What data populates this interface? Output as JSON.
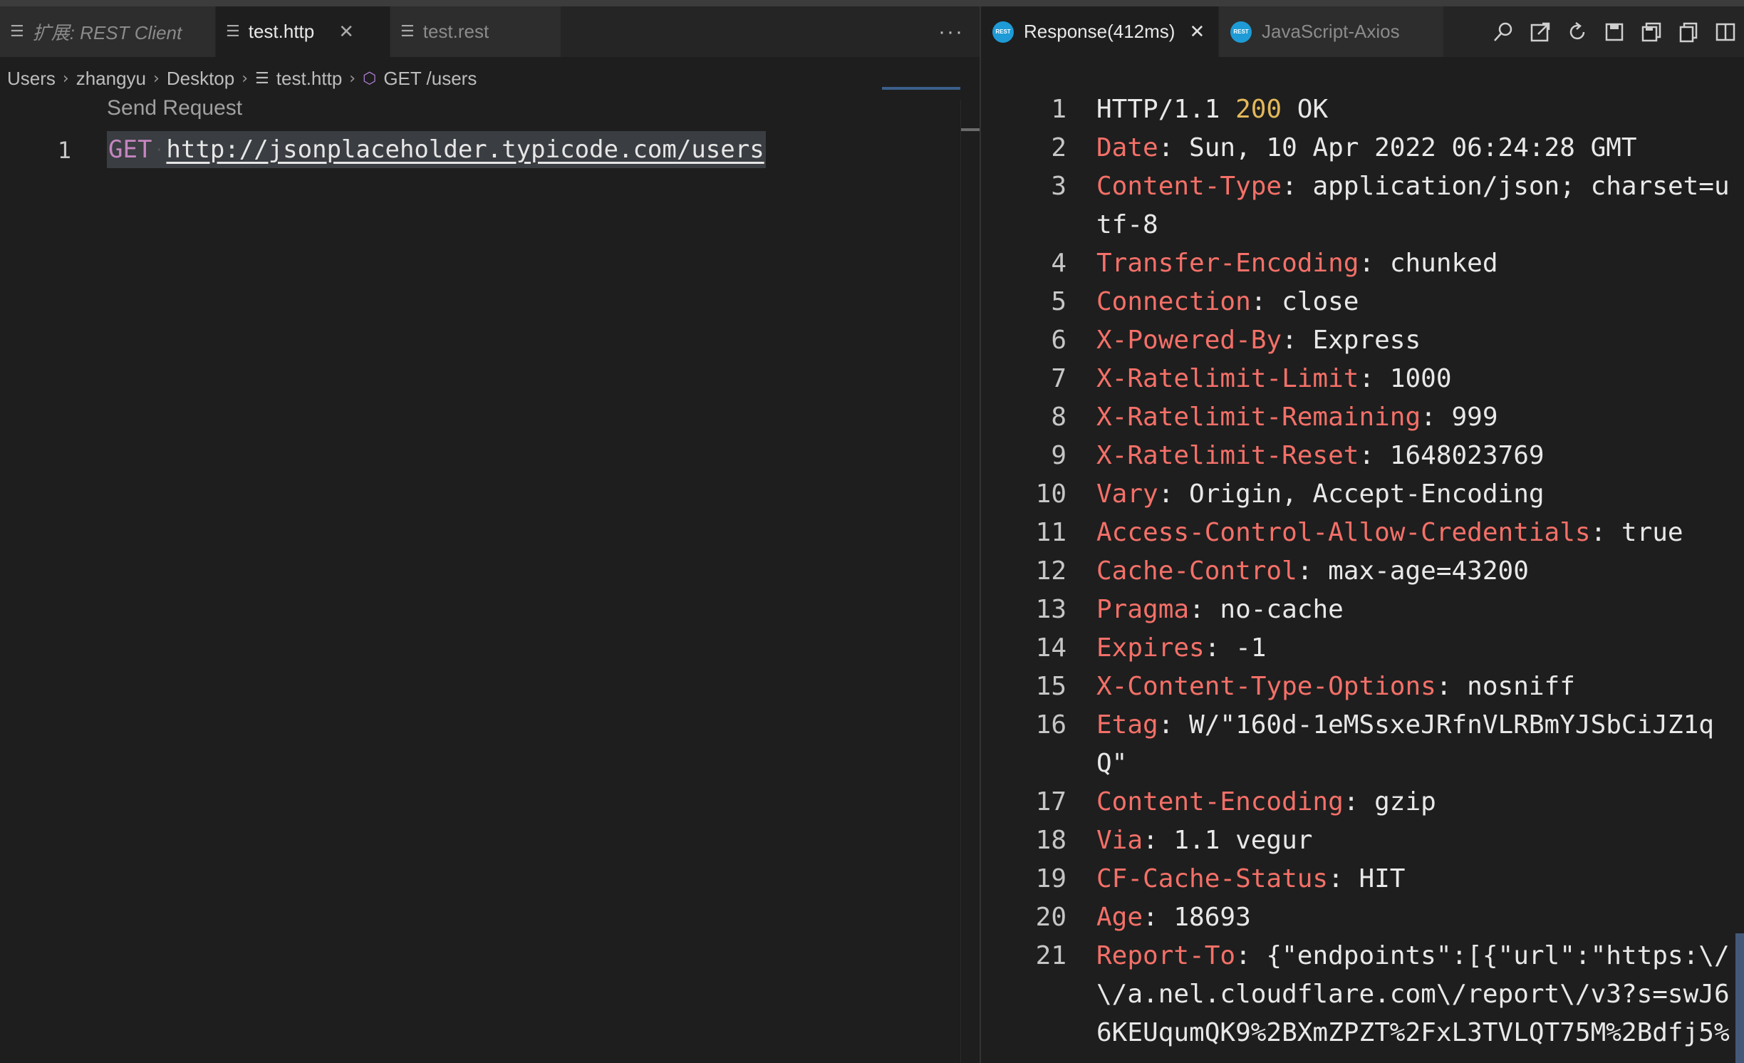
{
  "left": {
    "tabs": [
      {
        "label": "扩展: REST Client",
        "italic": true,
        "active": false
      },
      {
        "label": "test.http",
        "active": true,
        "closable": true
      },
      {
        "label": "test.rest",
        "active": false
      }
    ],
    "breadcrumb": [
      "Users",
      "zhangyu",
      "Desktop",
      "test.http",
      "GET /users"
    ],
    "codelens": "Send Request",
    "line_number": "1",
    "request": {
      "method": "GET",
      "url": "http://jsonplaceholder.typicode.com/users"
    }
  },
  "right": {
    "tabs": [
      {
        "label": "Response(412ms)",
        "active": true
      },
      {
        "label": "JavaScript-Axios",
        "active": false
      }
    ],
    "toolbar_icons": [
      "search-icon",
      "open-in-new-icon",
      "refresh-icon",
      "save-icon",
      "save-body-icon",
      "copy-icon",
      "split-editor-icon"
    ],
    "lines": [
      {
        "n": "1",
        "parts": [
          {
            "t": "HTTP/1.1 ",
            "c": ""
          },
          {
            "t": "200",
            "c": "num"
          },
          {
            "t": " OK",
            "c": ""
          }
        ]
      },
      {
        "n": "2",
        "parts": [
          {
            "t": "Date",
            "c": "k"
          },
          {
            "t": ": Sun, 10 Apr 2022 06:24:28 GMT",
            "c": ""
          }
        ]
      },
      {
        "n": "3",
        "parts": [
          {
            "t": "Content-Type",
            "c": "k"
          },
          {
            "t": ": application/json; charset=u",
            "c": ""
          }
        ]
      },
      {
        "n": "",
        "parts": [
          {
            "t": "tf-8",
            "c": ""
          }
        ]
      },
      {
        "n": "4",
        "parts": [
          {
            "t": "Transfer-Encoding",
            "c": "k"
          },
          {
            "t": ": chunked",
            "c": ""
          }
        ]
      },
      {
        "n": "5",
        "parts": [
          {
            "t": "Connection",
            "c": "k"
          },
          {
            "t": ": close",
            "c": ""
          }
        ]
      },
      {
        "n": "6",
        "parts": [
          {
            "t": "X-Powered-By",
            "c": "k"
          },
          {
            "t": ": Express",
            "c": ""
          }
        ]
      },
      {
        "n": "7",
        "parts": [
          {
            "t": "X-Ratelimit-Limit",
            "c": "k"
          },
          {
            "t": ": 1000",
            "c": ""
          }
        ]
      },
      {
        "n": "8",
        "parts": [
          {
            "t": "X-Ratelimit-Remaining",
            "c": "k"
          },
          {
            "t": ": 999",
            "c": ""
          }
        ]
      },
      {
        "n": "9",
        "parts": [
          {
            "t": "X-Ratelimit-Reset",
            "c": "k"
          },
          {
            "t": ": 1648023769",
            "c": ""
          }
        ]
      },
      {
        "n": "10",
        "parts": [
          {
            "t": "Vary",
            "c": "k"
          },
          {
            "t": ": Origin, Accept-Encoding",
            "c": ""
          }
        ]
      },
      {
        "n": "11",
        "parts": [
          {
            "t": "Access-Control-Allow-Credentials",
            "c": "k"
          },
          {
            "t": ": true",
            "c": ""
          }
        ]
      },
      {
        "n": "12",
        "parts": [
          {
            "t": "Cache-Control",
            "c": "k"
          },
          {
            "t": ": max-age=43200",
            "c": ""
          }
        ]
      },
      {
        "n": "13",
        "parts": [
          {
            "t": "Pragma",
            "c": "k"
          },
          {
            "t": ": no-cache",
            "c": ""
          }
        ]
      },
      {
        "n": "14",
        "parts": [
          {
            "t": "Expires",
            "c": "k"
          },
          {
            "t": ": -1",
            "c": ""
          }
        ]
      },
      {
        "n": "15",
        "parts": [
          {
            "t": "X-Content-Type-Options",
            "c": "k"
          },
          {
            "t": ": nosniff",
            "c": ""
          }
        ]
      },
      {
        "n": "16",
        "parts": [
          {
            "t": "Etag",
            "c": "k"
          },
          {
            "t": ": W/\"160d-1eMSsxeJRfnVLRBmYJSbCiJZ1q",
            "c": ""
          }
        ]
      },
      {
        "n": "",
        "parts": [
          {
            "t": "Q\"",
            "c": ""
          }
        ]
      },
      {
        "n": "17",
        "parts": [
          {
            "t": "Content-Encoding",
            "c": "k"
          },
          {
            "t": ": gzip",
            "c": ""
          }
        ]
      },
      {
        "n": "18",
        "parts": [
          {
            "t": "Via",
            "c": "k"
          },
          {
            "t": ": 1.1 vegur",
            "c": ""
          }
        ]
      },
      {
        "n": "19",
        "parts": [
          {
            "t": "CF-Cache-Status",
            "c": "k"
          },
          {
            "t": ": HIT",
            "c": ""
          }
        ]
      },
      {
        "n": "20",
        "parts": [
          {
            "t": "Age",
            "c": "k"
          },
          {
            "t": ": 18693",
            "c": ""
          }
        ]
      },
      {
        "n": "21",
        "parts": [
          {
            "t": "Report-To",
            "c": "k"
          },
          {
            "t": ": {\"endpoints\":[{\"url\":\"https:\\/",
            "c": ""
          }
        ]
      },
      {
        "n": "",
        "parts": [
          {
            "t": "\\/a.nel.cloudflare.com\\/report\\/v3?s=swJ6",
            "c": ""
          }
        ]
      },
      {
        "n": "",
        "parts": [
          {
            "t": "6KEUqumQK9%2BXmZPZT%2FxL3TVLQT75M%2Bdfj5%",
            "c": ""
          }
        ]
      }
    ]
  },
  "colors": {
    "key": "#f47068",
    "number": "#e2b85a",
    "method": "#c586c0",
    "accent": "#1e9bd6"
  }
}
